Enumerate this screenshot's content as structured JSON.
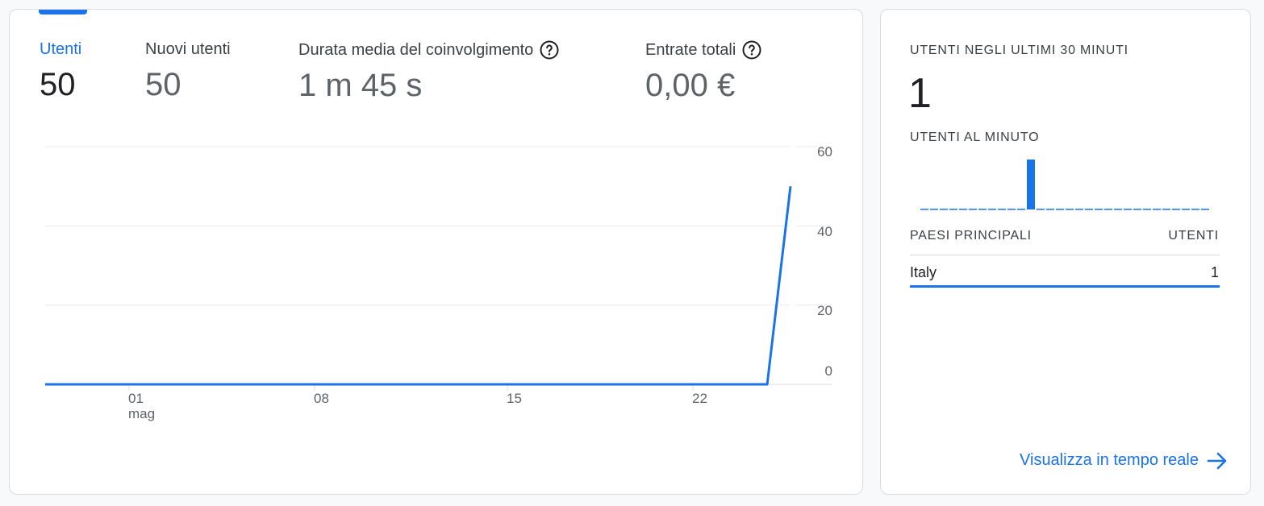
{
  "colors": {
    "accent": "#1a73e8",
    "text_primary": "#202124",
    "text_secondary": "#5f6368",
    "gridline": "#e8eaed"
  },
  "metrics": [
    {
      "label": "Utenti",
      "value": "50",
      "selected": true,
      "has_help": false
    },
    {
      "label": "Nuovi utenti",
      "value": "50",
      "selected": false,
      "has_help": false
    },
    {
      "label": "Durata media del coinvolgimento",
      "value": "1 m 45 s",
      "selected": false,
      "has_help": true
    },
    {
      "label": "Entrate totali",
      "value": "0,00 €",
      "selected": false,
      "has_help": true
    }
  ],
  "help_icon": "question-circle-icon",
  "chart_data": {
    "type": "line",
    "series": [
      {
        "values": [
          0,
          0,
          0,
          0,
          0,
          0,
          0,
          0,
          0,
          0,
          0,
          0,
          0,
          0,
          0,
          0,
          0,
          0,
          0,
          0,
          0,
          0,
          0,
          0,
          0,
          0,
          0,
          0,
          0,
          0,
          0,
          0,
          50
        ]
      }
    ],
    "x_tick_labels": [
      [
        "01",
        "mag"
      ],
      [
        "08"
      ],
      [
        "15"
      ],
      [
        "22"
      ]
    ],
    "y_tick_labels": [
      "60",
      "40",
      "20",
      "0"
    ],
    "ylim": [
      0,
      60
    ],
    "grid": true,
    "y_axis_position": "right"
  },
  "realtime": {
    "heading": "UTENTI NEGLI ULTIMI 30 MINUTI",
    "count": "1",
    "per_minute_heading": "UTENTI AL MINUTO",
    "per_minute_values": [
      0,
      0,
      0,
      0,
      0,
      0,
      0,
      0,
      0,
      0,
      0,
      1,
      0,
      0,
      0,
      0,
      0,
      0,
      0,
      0,
      0,
      0,
      0,
      0,
      0,
      0,
      0,
      0,
      0,
      0
    ],
    "table_col1": "PAESI PRINCIPALI",
    "table_col2": "UTENTI",
    "rows": [
      {
        "country": "Italy",
        "users": "1"
      }
    ],
    "link_label": "Visualizza in tempo reale",
    "link_icon": "arrow-right-icon"
  }
}
